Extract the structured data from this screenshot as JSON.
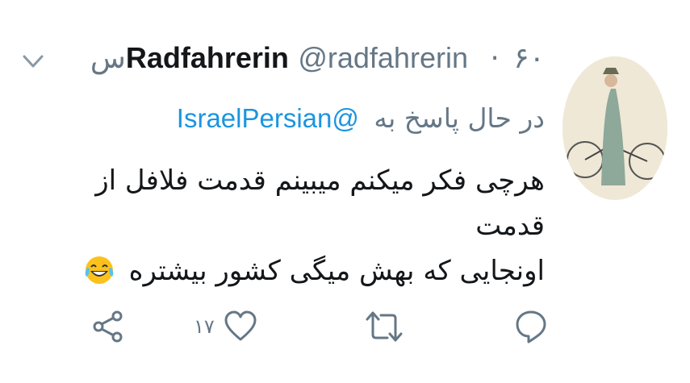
{
  "tweet": {
    "display_name": "Radfahrerin",
    "handle": "@radfahrerin",
    "separator": "·",
    "time": "۶۰س",
    "reply_prefix": "در حال پاسخ به",
    "reply_to": "@IsraelPersian",
    "text_line1": "هرچی فکر میکنم میبینم قدمت فلافل از قدمت",
    "text_line2": "اونجایی که بهش میگی کشور بیشتره"
  },
  "actions": {
    "like_count": "۱۷"
  },
  "colors": {
    "text": "#14171a",
    "secondary": "#657786",
    "link": "#1b95e0"
  },
  "icons": [
    "chevron-down-icon",
    "reply-icon",
    "retweet-icon",
    "like-icon",
    "share-icon",
    "tears-of-joy-emoji"
  ]
}
